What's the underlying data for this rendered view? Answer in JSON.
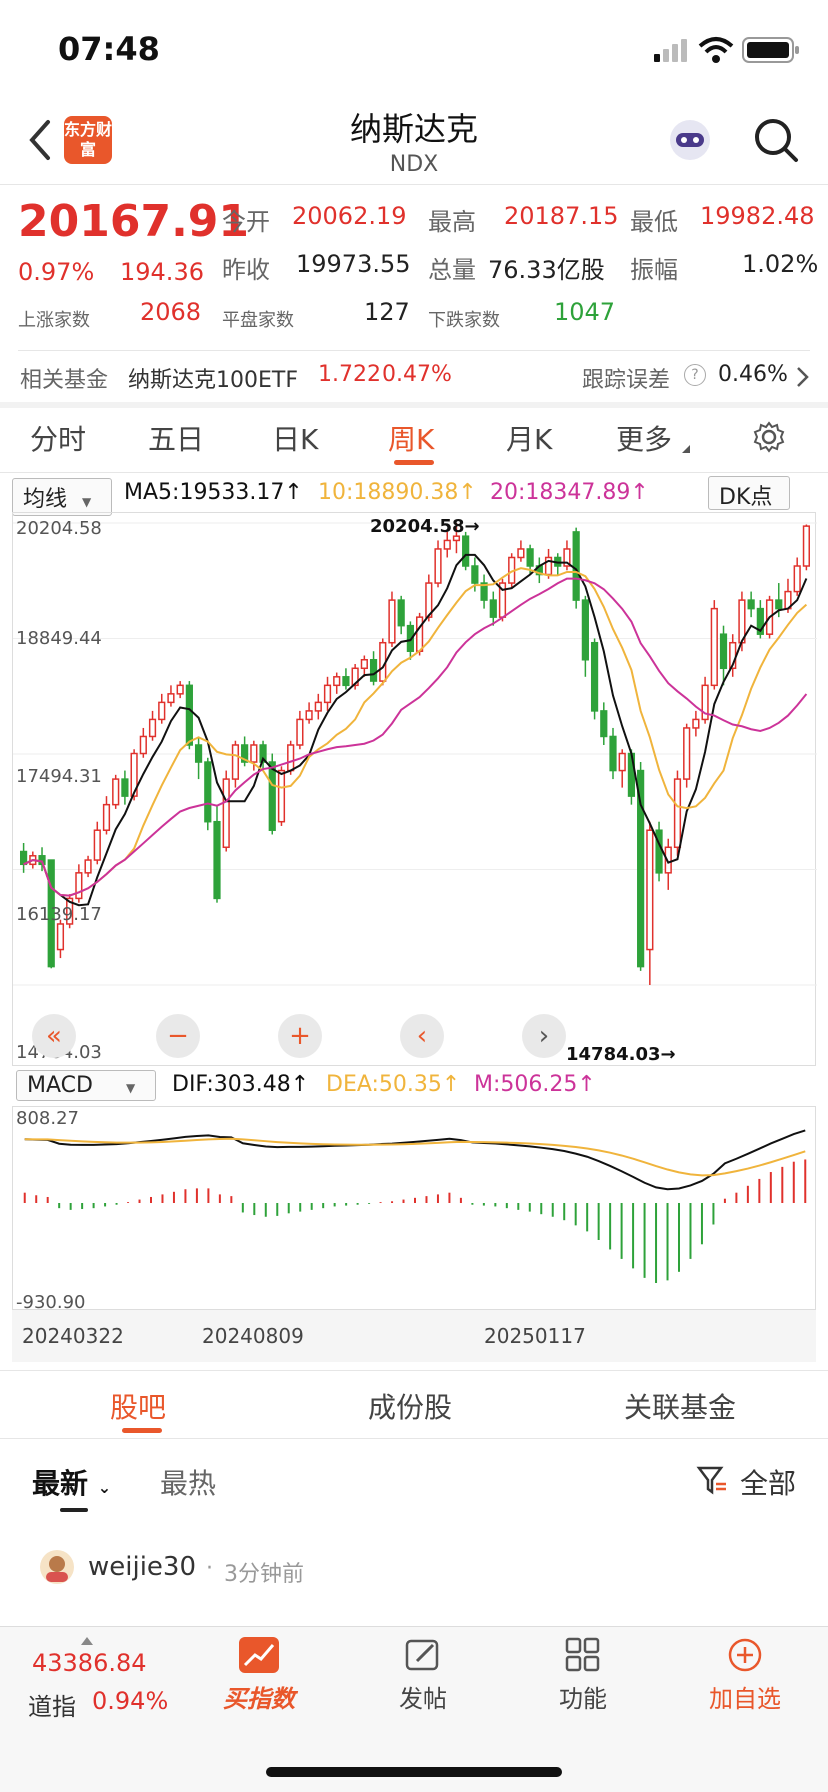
{
  "status": {
    "time": "07:48"
  },
  "header": {
    "title": "纳斯达克",
    "subtitle": "NDX",
    "logo_text": "东方财富"
  },
  "quote": {
    "price": "20167.91",
    "pct": "0.97%",
    "change": "194.36",
    "open_label": "今开",
    "open": "20062.19",
    "high_label": "最高",
    "high": "20187.15",
    "low_label": "最低",
    "low": "19982.48",
    "prev_label": "昨收",
    "prev": "19973.55",
    "volume_label": "总量",
    "volume": "76.33亿股",
    "amp_label": "振幅",
    "amp": "1.02%",
    "up_label": "上涨家数",
    "up": "2068",
    "flat_label": "平盘家数",
    "flat": "127",
    "down_label": "下跌家数",
    "down": "1047"
  },
  "fund": {
    "label": "相关基金",
    "name": "纳斯达克100ETF",
    "price": "1.722",
    "pct": "0.47%",
    "track_label": "跟踪误差",
    "track_value": "0.46%"
  },
  "tabs": [
    "分时",
    "五日",
    "日K",
    "周K",
    "月K",
    "更多"
  ],
  "active_tab": "周K",
  "chart": {
    "ma_select": "均线",
    "ma5": "MA5:19533.17",
    "ma10": "10:18890.38",
    "ma20": "20:18347.89",
    "dk": "DK点",
    "y_labels": [
      "20204.58",
      "18849.44",
      "17494.31",
      "16139.17",
      "14784.03"
    ],
    "max_note": "20204.58→",
    "min_note": "14784.03→",
    "macd_select": "MACD",
    "dif": "DIF:303.48",
    "dea": "DEA:50.35",
    "m": "M:506.25",
    "macd_top": "808.27",
    "macd_bottom": "-930.90",
    "dates": [
      "20240322",
      "20240809",
      "20250117"
    ],
    "colors": {
      "up": "#e0312c",
      "down": "#2ea23a",
      "ma5": "#111111",
      "ma10": "#f0b43c",
      "ma20": "#cc3399"
    }
  },
  "chart_data": {
    "type": "candlestick",
    "ylim": [
      14784.03,
      20204.58
    ],
    "candles": [
      {
        "o": 16350,
        "c": 16200,
        "h": 16450,
        "l": 16100
      },
      {
        "o": 16200,
        "c": 16300,
        "h": 16350,
        "l": 16150
      },
      {
        "o": 16300,
        "c": 16200,
        "h": 16400,
        "l": 16120
      },
      {
        "o": 16250,
        "c": 15000,
        "h": 16250,
        "l": 14980
      },
      {
        "o": 15200,
        "c": 15500,
        "h": 15550,
        "l": 15100
      },
      {
        "o": 15500,
        "c": 15800,
        "h": 15850,
        "l": 15450
      },
      {
        "o": 15800,
        "c": 16100,
        "h": 16200,
        "l": 15750
      },
      {
        "o": 16100,
        "c": 16250,
        "h": 16300,
        "l": 16050
      },
      {
        "o": 16250,
        "c": 16600,
        "h": 16700,
        "l": 16200
      },
      {
        "o": 16600,
        "c": 16900,
        "h": 17000,
        "l": 16550
      },
      {
        "o": 16900,
        "c": 17200,
        "h": 17250,
        "l": 16850
      },
      {
        "o": 17200,
        "c": 17000,
        "h": 17300,
        "l": 16900
      },
      {
        "o": 17000,
        "c": 17500,
        "h": 17550,
        "l": 16950
      },
      {
        "o": 17500,
        "c": 17700,
        "h": 17800,
        "l": 17450
      },
      {
        "o": 17700,
        "c": 17900,
        "h": 18000,
        "l": 17650
      },
      {
        "o": 17900,
        "c": 18100,
        "h": 18200,
        "l": 17850
      },
      {
        "o": 18100,
        "c": 18200,
        "h": 18300,
        "l": 18050
      },
      {
        "o": 18200,
        "c": 18300,
        "h": 18350,
        "l": 18150
      },
      {
        "o": 18300,
        "c": 17600,
        "h": 18350,
        "l": 17550
      },
      {
        "o": 17600,
        "c": 17400,
        "h": 17700,
        "l": 17200
      },
      {
        "o": 17400,
        "c": 16700,
        "h": 17450,
        "l": 16600
      },
      {
        "o": 16700,
        "c": 15800,
        "h": 16900,
        "l": 15750
      },
      {
        "o": 16400,
        "c": 17200,
        "h": 17300,
        "l": 16350
      },
      {
        "o": 17200,
        "c": 17600,
        "h": 17650,
        "l": 17100
      },
      {
        "o": 17600,
        "c": 17400,
        "h": 17700,
        "l": 17350
      },
      {
        "o": 17400,
        "c": 17600,
        "h": 17650,
        "l": 17300
      },
      {
        "o": 17600,
        "c": 17400,
        "h": 17650,
        "l": 17300
      },
      {
        "o": 17400,
        "c": 16600,
        "h": 17500,
        "l": 16550
      },
      {
        "o": 16700,
        "c": 17300,
        "h": 17350,
        "l": 16650
      },
      {
        "o": 17300,
        "c": 17600,
        "h": 17650,
        "l": 17250
      },
      {
        "o": 17600,
        "c": 17900,
        "h": 18000,
        "l": 17550
      },
      {
        "o": 17900,
        "c": 18000,
        "h": 18100,
        "l": 17850
      },
      {
        "o": 18000,
        "c": 18100,
        "h": 18200,
        "l": 17900
      },
      {
        "o": 18100,
        "c": 18300,
        "h": 18400,
        "l": 18000
      },
      {
        "o": 18300,
        "c": 18400,
        "h": 18450,
        "l": 18200
      },
      {
        "o": 18400,
        "c": 18300,
        "h": 18500,
        "l": 18250
      },
      {
        "o": 18300,
        "c": 18500,
        "h": 18550,
        "l": 18250
      },
      {
        "o": 18500,
        "c": 18600,
        "h": 18650,
        "l": 18400
      },
      {
        "o": 18600,
        "c": 18350,
        "h": 18700,
        "l": 18300
      },
      {
        "o": 18350,
        "c": 18800,
        "h": 18850,
        "l": 18300
      },
      {
        "o": 18800,
        "c": 19300,
        "h": 19400,
        "l": 18750
      },
      {
        "o": 19300,
        "c": 19000,
        "h": 19350,
        "l": 18900
      },
      {
        "o": 19000,
        "c": 18700,
        "h": 19050,
        "l": 18600
      },
      {
        "o": 18700,
        "c": 19100,
        "h": 19150,
        "l": 18650
      },
      {
        "o": 19100,
        "c": 19500,
        "h": 19600,
        "l": 19050
      },
      {
        "o": 19500,
        "c": 19900,
        "h": 20000,
        "l": 19450
      },
      {
        "o": 19900,
        "c": 20000,
        "h": 20100,
        "l": 19800
      },
      {
        "o": 20000,
        "c": 20050,
        "h": 20204.58,
        "l": 19850
      },
      {
        "o": 20050,
        "c": 19700,
        "h": 20100,
        "l": 19650
      },
      {
        "o": 19700,
        "c": 19500,
        "h": 19800,
        "l": 19400
      },
      {
        "o": 19500,
        "c": 19300,
        "h": 19600,
        "l": 19200
      },
      {
        "o": 19300,
        "c": 19100,
        "h": 19400,
        "l": 19000
      },
      {
        "o": 19100,
        "c": 19500,
        "h": 19550,
        "l": 19050
      },
      {
        "o": 19500,
        "c": 19800,
        "h": 19850,
        "l": 19450
      },
      {
        "o": 19800,
        "c": 19900,
        "h": 20000,
        "l": 19750
      },
      {
        "o": 19900,
        "c": 19700,
        "h": 19950,
        "l": 19600
      },
      {
        "o": 19700,
        "c": 19600,
        "h": 19800,
        "l": 19500
      },
      {
        "o": 19600,
        "c": 19800,
        "h": 19900,
        "l": 19550
      },
      {
        "o": 19800,
        "c": 19700,
        "h": 19850,
        "l": 19600
      },
      {
        "o": 19700,
        "c": 19900,
        "h": 20000,
        "l": 19650
      },
      {
        "o": 20100,
        "c": 19300,
        "h": 20150,
        "l": 19200
      },
      {
        "o": 19300,
        "c": 18600,
        "h": 19350,
        "l": 18400
      },
      {
        "o": 18800,
        "c": 18000,
        "h": 18850,
        "l": 17900
      },
      {
        "o": 18000,
        "c": 17700,
        "h": 18100,
        "l": 17600
      },
      {
        "o": 17700,
        "c": 17300,
        "h": 17800,
        "l": 17200
      },
      {
        "o": 17300,
        "c": 17500,
        "h": 17550,
        "l": 17100
      },
      {
        "o": 17500,
        "c": 17000,
        "h": 17550,
        "l": 16900
      },
      {
        "o": 17300,
        "c": 15000,
        "h": 17400,
        "l": 14950
      },
      {
        "o": 15200,
        "c": 16600,
        "h": 16700,
        "l": 14784.03
      },
      {
        "o": 16600,
        "c": 16100,
        "h": 16700,
        "l": 16000
      },
      {
        "o": 16100,
        "c": 16400,
        "h": 16500,
        "l": 15900
      },
      {
        "o": 16400,
        "c": 17200,
        "h": 17300,
        "l": 16300
      },
      {
        "o": 17200,
        "c": 17800,
        "h": 17850,
        "l": 17100
      },
      {
        "o": 17800,
        "c": 17900,
        "h": 18000,
        "l": 17700
      },
      {
        "o": 17900,
        "c": 18300,
        "h": 18400,
        "l": 17850
      },
      {
        "o": 18300,
        "c": 19200,
        "h": 19300,
        "l": 18250
      },
      {
        "o": 18900,
        "c": 18500,
        "h": 19000,
        "l": 18300
      },
      {
        "o": 18500,
        "c": 18800,
        "h": 18900,
        "l": 18400
      },
      {
        "o": 18800,
        "c": 19300,
        "h": 19400,
        "l": 18700
      },
      {
        "o": 19300,
        "c": 19200,
        "h": 19400,
        "l": 19100
      },
      {
        "o": 19200,
        "c": 18900,
        "h": 19300,
        "l": 18850
      },
      {
        "o": 18900,
        "c": 19300,
        "h": 19350,
        "l": 18850
      },
      {
        "o": 19300,
        "c": 19200,
        "h": 19500,
        "l": 19100
      },
      {
        "o": 19200,
        "c": 19400,
        "h": 19550,
        "l": 19150
      },
      {
        "o": 19400,
        "c": 19700,
        "h": 19800,
        "l": 19350
      },
      {
        "o": 19700,
        "c": 20167.91,
        "h": 20187.15,
        "l": 19650
      }
    ],
    "macd_hist": [
      120,
      90,
      70,
      -60,
      -80,
      -70,
      -60,
      -40,
      -20,
      10,
      40,
      70,
      100,
      130,
      160,
      170,
      170,
      100,
      80,
      -110,
      -140,
      -160,
      -150,
      -120,
      -100,
      -80,
      -60,
      -40,
      -30,
      -20,
      -10,
      10,
      20,
      40,
      60,
      80,
      100,
      120,
      60,
      -20,
      -30,
      -40,
      -60,
      -80,
      -100,
      -130,
      -160,
      -200,
      -260,
      -330,
      -430,
      -540,
      -650,
      -760,
      -870,
      -930,
      -900,
      -800,
      -650,
      -480,
      -250,
      50,
      120,
      200,
      280,
      360,
      420,
      480,
      506
    ]
  },
  "bottom_tabs": [
    "股吧",
    "成份股",
    "关联基金"
  ],
  "filters": {
    "latest": "最新",
    "hot": "最热",
    "all": "全部"
  },
  "post": {
    "user": "weijie30",
    "time": "3分钟前"
  },
  "tabbar": {
    "index_value": "43386.84",
    "index_name": "道指",
    "index_pct": "0.94%",
    "items": [
      "买指数",
      "发帖",
      "功能",
      "加自选"
    ]
  }
}
